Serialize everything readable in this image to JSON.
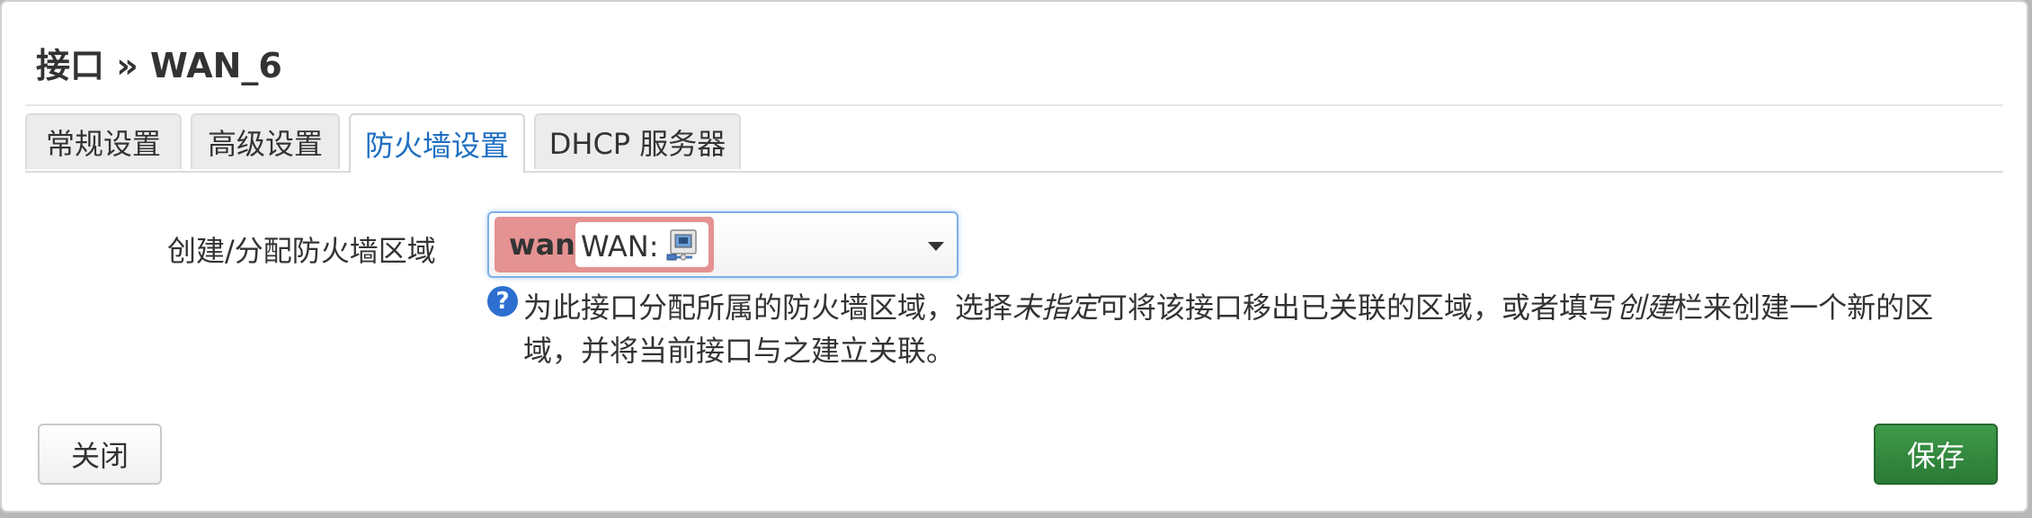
{
  "dialog": {
    "title": "接口 » WAN_6"
  },
  "tabs": [
    {
      "label": "常规设置",
      "active": false
    },
    {
      "label": "高级设置",
      "active": false
    },
    {
      "label": "防火墙设置",
      "active": true
    },
    {
      "label": "DHCP 服务器",
      "active": false
    }
  ],
  "firewall": {
    "field_label": "创建/分配防火墙区域",
    "selected_zone": {
      "name": "wan",
      "network_label": "WAN:",
      "icon": "network-port-icon",
      "color": "#e59292"
    },
    "help": {
      "part1": "为此接口分配所属的防火墙区域，选择",
      "em1": "未指定",
      "part2": "可将该接口移出已关联的区域，或者填写",
      "em2": "创建",
      "part3": "栏来创建一个新的区域，并将当前接口与之建立关联。"
    }
  },
  "footer": {
    "close_label": "关闭",
    "save_label": "保存"
  },
  "colors": {
    "active_tab_text": "#1e6fc2",
    "save_button": "#2f8a3b",
    "help_icon": "#2d6fd1"
  }
}
